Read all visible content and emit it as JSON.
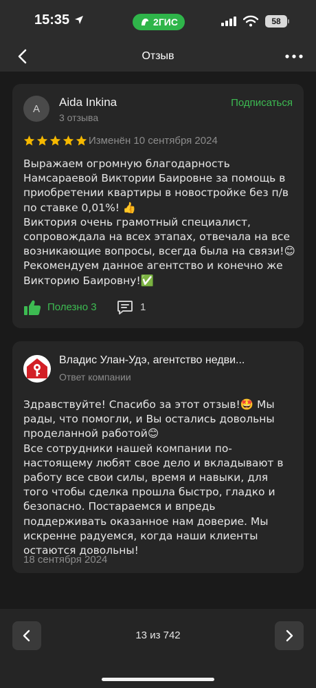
{
  "status_bar": {
    "time": "15:35",
    "brand": "2ГИС",
    "battery": "58"
  },
  "header": {
    "title": "Отзыв"
  },
  "review": {
    "avatar_initial": "A",
    "author": "Aida Inkina",
    "reviews_count": "3 отзыва",
    "subscribe_label": "Подписаться",
    "rating": 5,
    "edited": "Изменён 10 сентября 2024",
    "text": "Выражаем огромную благодарность Намсараевой Виктории Баировне за помощь в приобретении квартиры в новостройке без п/в по ставке 0,01%! 👍\nВиктория очень грамотный специалист, сопровождала на всех этапах, отвечала на все возникающие вопросы, всегда была на связи!😊\nРекомендуем данное агентство и конечно же Викторию Баировну!✅",
    "helpful_label": "Полезно 3",
    "comments_count": "1"
  },
  "reply": {
    "company_name": "Владис Улан-Удэ, агентство недви...",
    "subtitle": "Ответ компании",
    "text": "Здравствуйте! Спасибо за этот отзыв!🤩 Мы рады, что помогли, и Вы остались довольны проделанной работой😊\nВсе сотрудники нашей компании по-настоящему любят свое дело и вкладывают в работу все свои силы, время и навыки, для того чтобы сделка прошла быстро, гладко и безопасно. Постараемся и впредь поддерживать оказанное нам доверие. Мы искренне радуемся, когда наши клиенты остаются довольны!",
    "date": "18 сентября 2024"
  },
  "pagination": {
    "label": "13 из 742"
  },
  "colors": {
    "accent": "#3dbb52",
    "star": "#f5b800",
    "brand": "#2fb54a",
    "logo_red": "#d32027"
  },
  "icons": [
    "location-arrow-icon",
    "brand-logo-icon",
    "signal-icon",
    "wifi-icon",
    "battery-icon",
    "back-chevron-icon",
    "more-dots-icon",
    "star-icon",
    "thumbs-up-icon",
    "comment-icon",
    "company-logo-icon",
    "chevron-left-icon",
    "chevron-right-icon"
  ]
}
